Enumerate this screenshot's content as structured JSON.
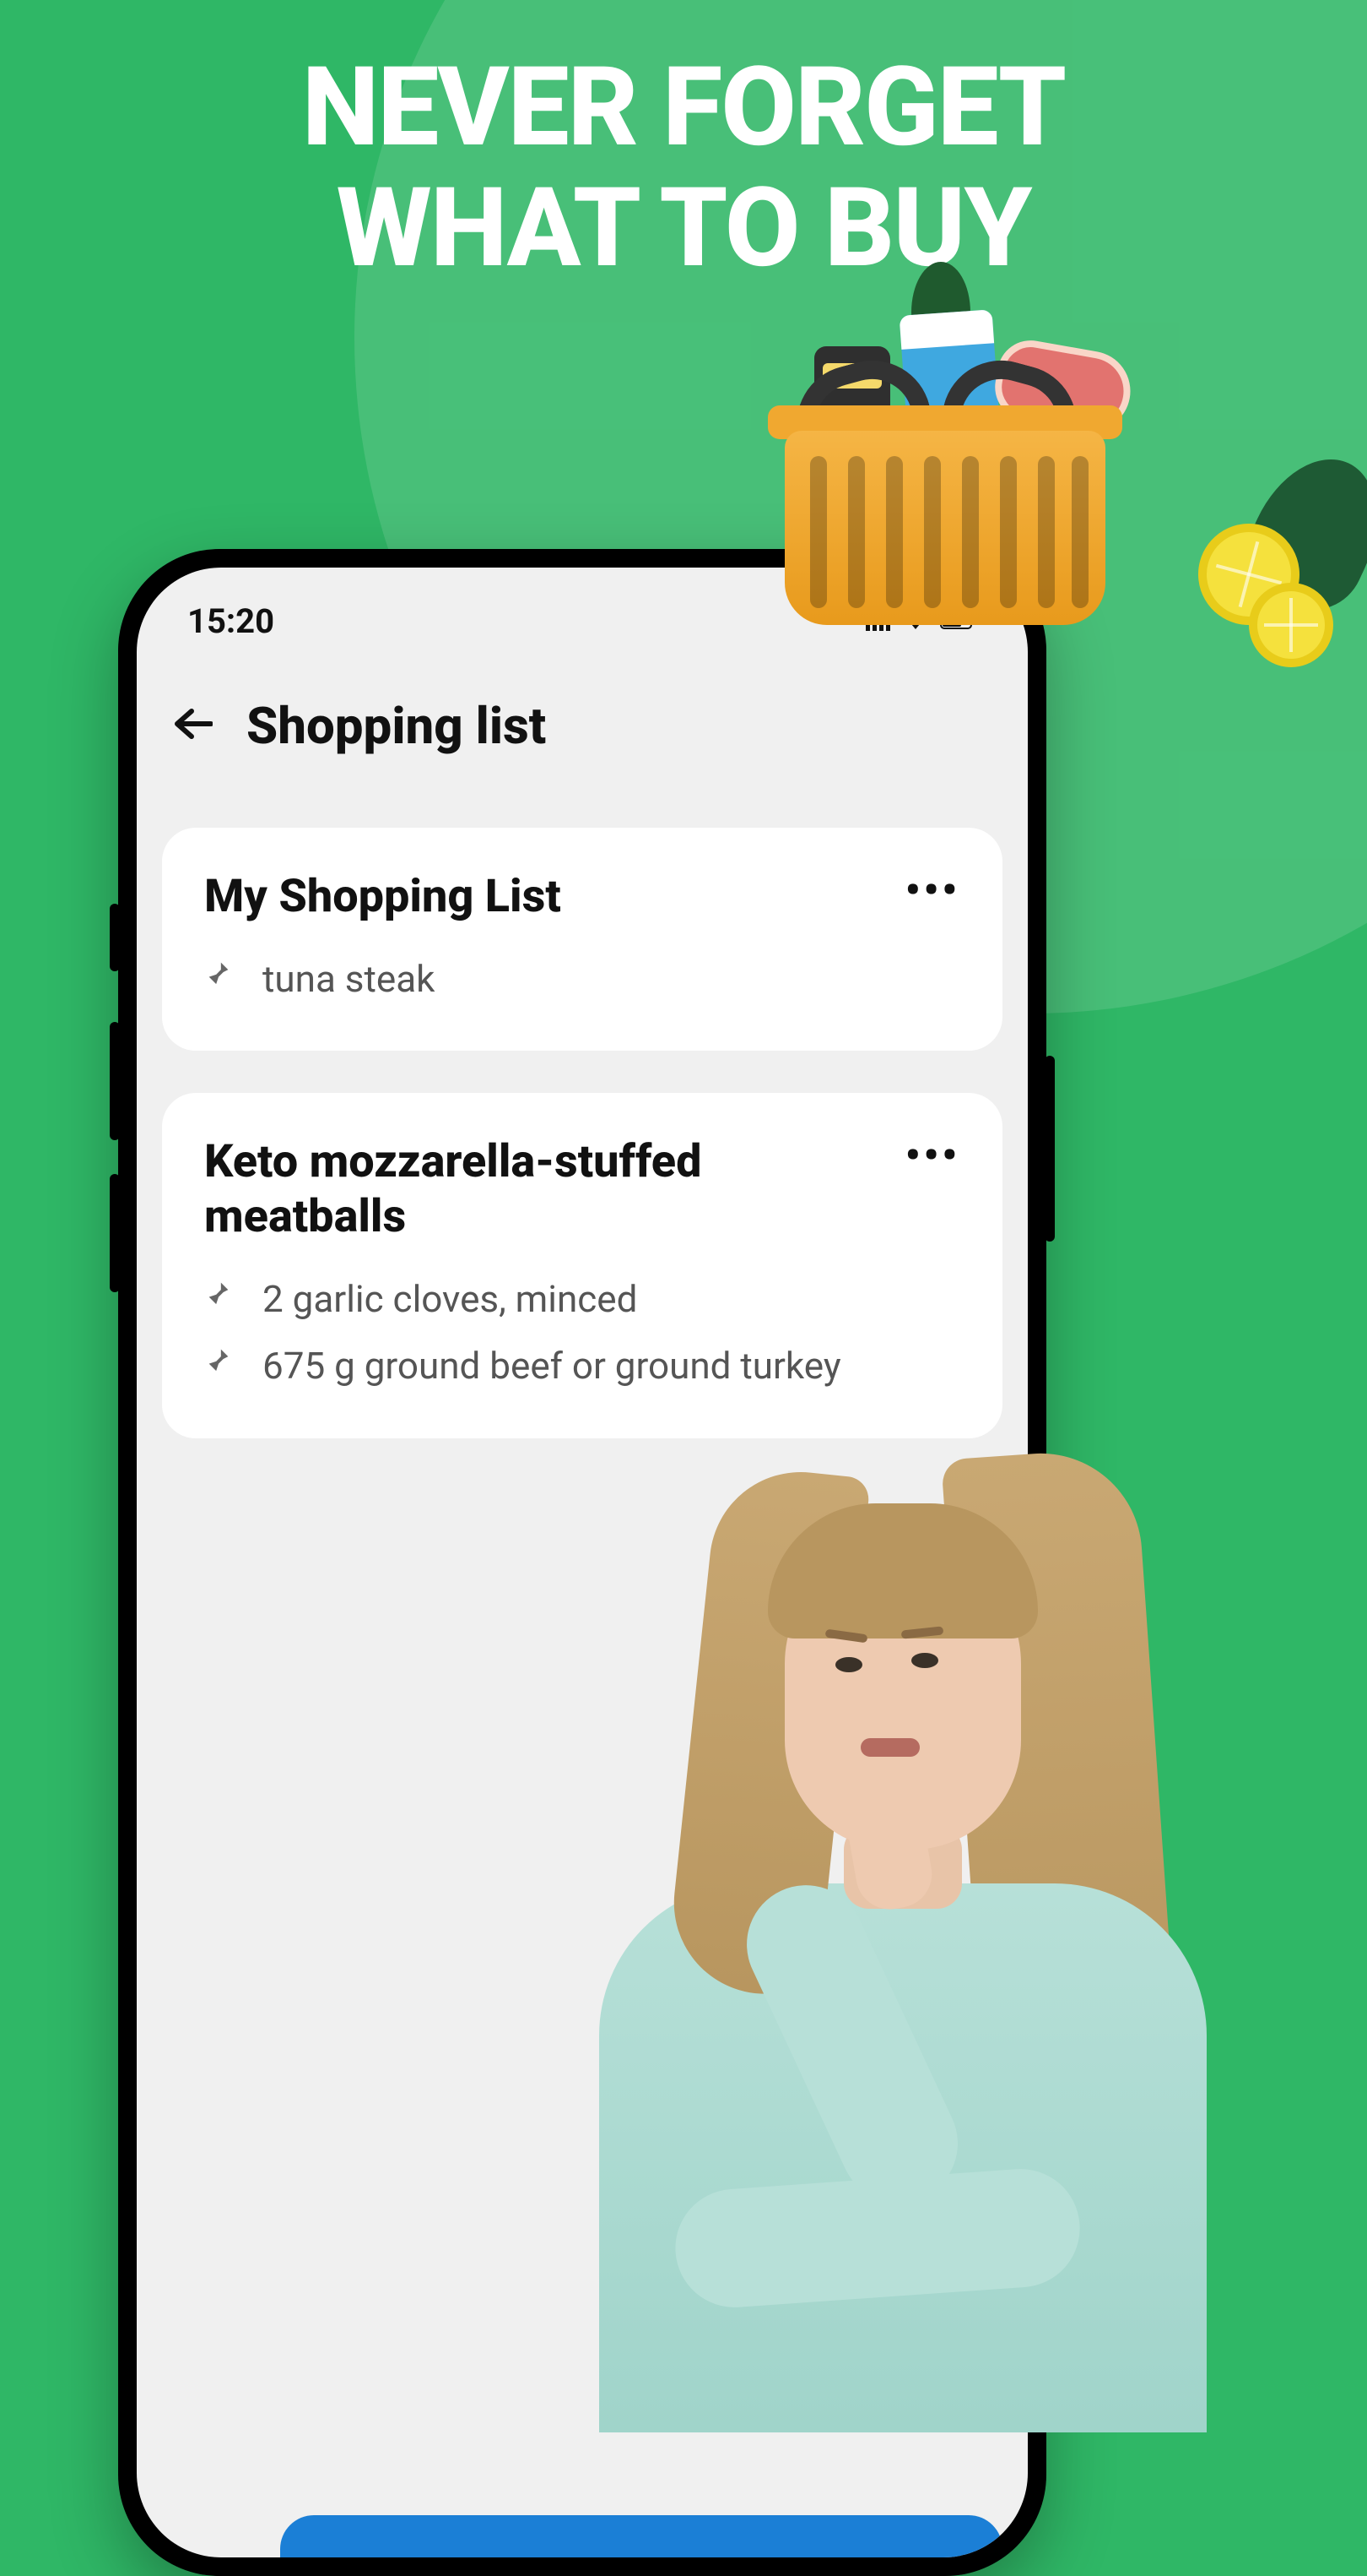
{
  "headline": {
    "line1": "NEVER FORGET",
    "line2": "WHAT TO BUY"
  },
  "statusBar": {
    "time": "15:20"
  },
  "header": {
    "title": "Shopping list"
  },
  "lists": [
    {
      "title": "My Shopping List",
      "items": [
        {
          "text": "tuna steak"
        }
      ]
    },
    {
      "title": "Keto mozzarella-stuffed meatballs",
      "items": [
        {
          "text": "2 garlic cloves, minced"
        },
        {
          "text": "675 g ground beef or ground turkey"
        }
      ]
    }
  ]
}
